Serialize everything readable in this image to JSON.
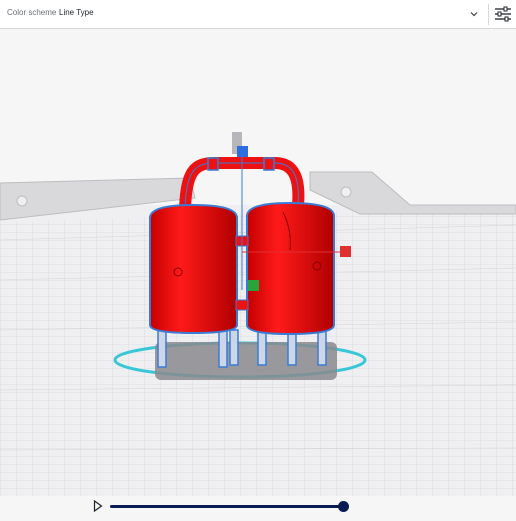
{
  "toolbar": {
    "color_scheme_label": "Color scheme",
    "color_scheme_value": "Line Type"
  },
  "icons": {
    "dropdown": "chevron-down-icon",
    "settings": "sliders-icon",
    "play": "play-icon"
  },
  "colors": {
    "model_fill": "#ee1111",
    "outline": "#3a7bd5",
    "selection_ring": "#39c6d6",
    "slider": "#0a1a55"
  }
}
